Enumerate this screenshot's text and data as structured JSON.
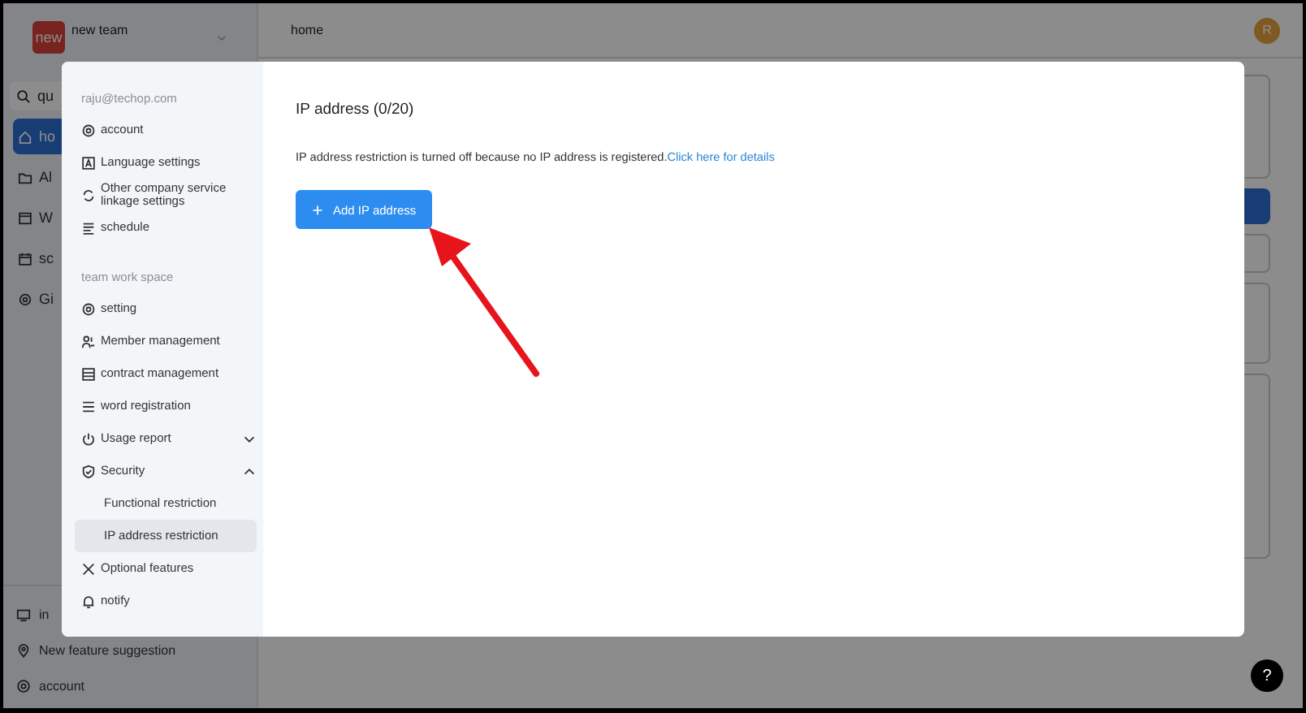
{
  "app": {
    "team": {
      "badge": "new",
      "name": "new team"
    },
    "search": {
      "value": "qu"
    },
    "nav": [
      {
        "label": "ho",
        "selected": true
      },
      {
        "label": "Al",
        "selected": false
      },
      {
        "label": "W",
        "selected": false
      },
      {
        "label": "sc",
        "selected": false
      },
      {
        "label": "Gi",
        "selected": false
      }
    ],
    "bottom_nav": [
      {
        "label": "in"
      },
      {
        "label": "New feature suggestion"
      },
      {
        "label": "account"
      }
    ],
    "header": {
      "title": "home",
      "avatar": "R"
    },
    "help": "?"
  },
  "modal": {
    "email": "raju@techop.com",
    "menu": [
      {
        "label": "account",
        "selected": false
      },
      {
        "label": "Language settings",
        "selected": false
      },
      {
        "label": "Other company service linkage settings",
        "selected": false
      },
      {
        "label": "schedule",
        "selected": false
      }
    ],
    "section_label": "team work space",
    "team_menu": [
      {
        "label": "setting",
        "selected": false
      },
      {
        "label": "Member management",
        "selected": false
      },
      {
        "label": "contract management",
        "selected": false
      },
      {
        "label": "word registration",
        "selected": false
      },
      {
        "label": "Usage report",
        "selected": false,
        "expanded": false
      },
      {
        "label": "Security",
        "selected": false,
        "expanded": true,
        "children": [
          {
            "label": "Functional restriction",
            "selected": false
          },
          {
            "label": "IP address restriction",
            "selected": true
          }
        ]
      },
      {
        "label": "Optional features",
        "selected": false
      },
      {
        "label": "notify",
        "selected": false
      }
    ],
    "content": {
      "title": "IP address (0/20)",
      "notice": "IP address restriction is turned off because no IP address is registered.",
      "link": "Click here for details",
      "button": "Add IP address"
    }
  }
}
